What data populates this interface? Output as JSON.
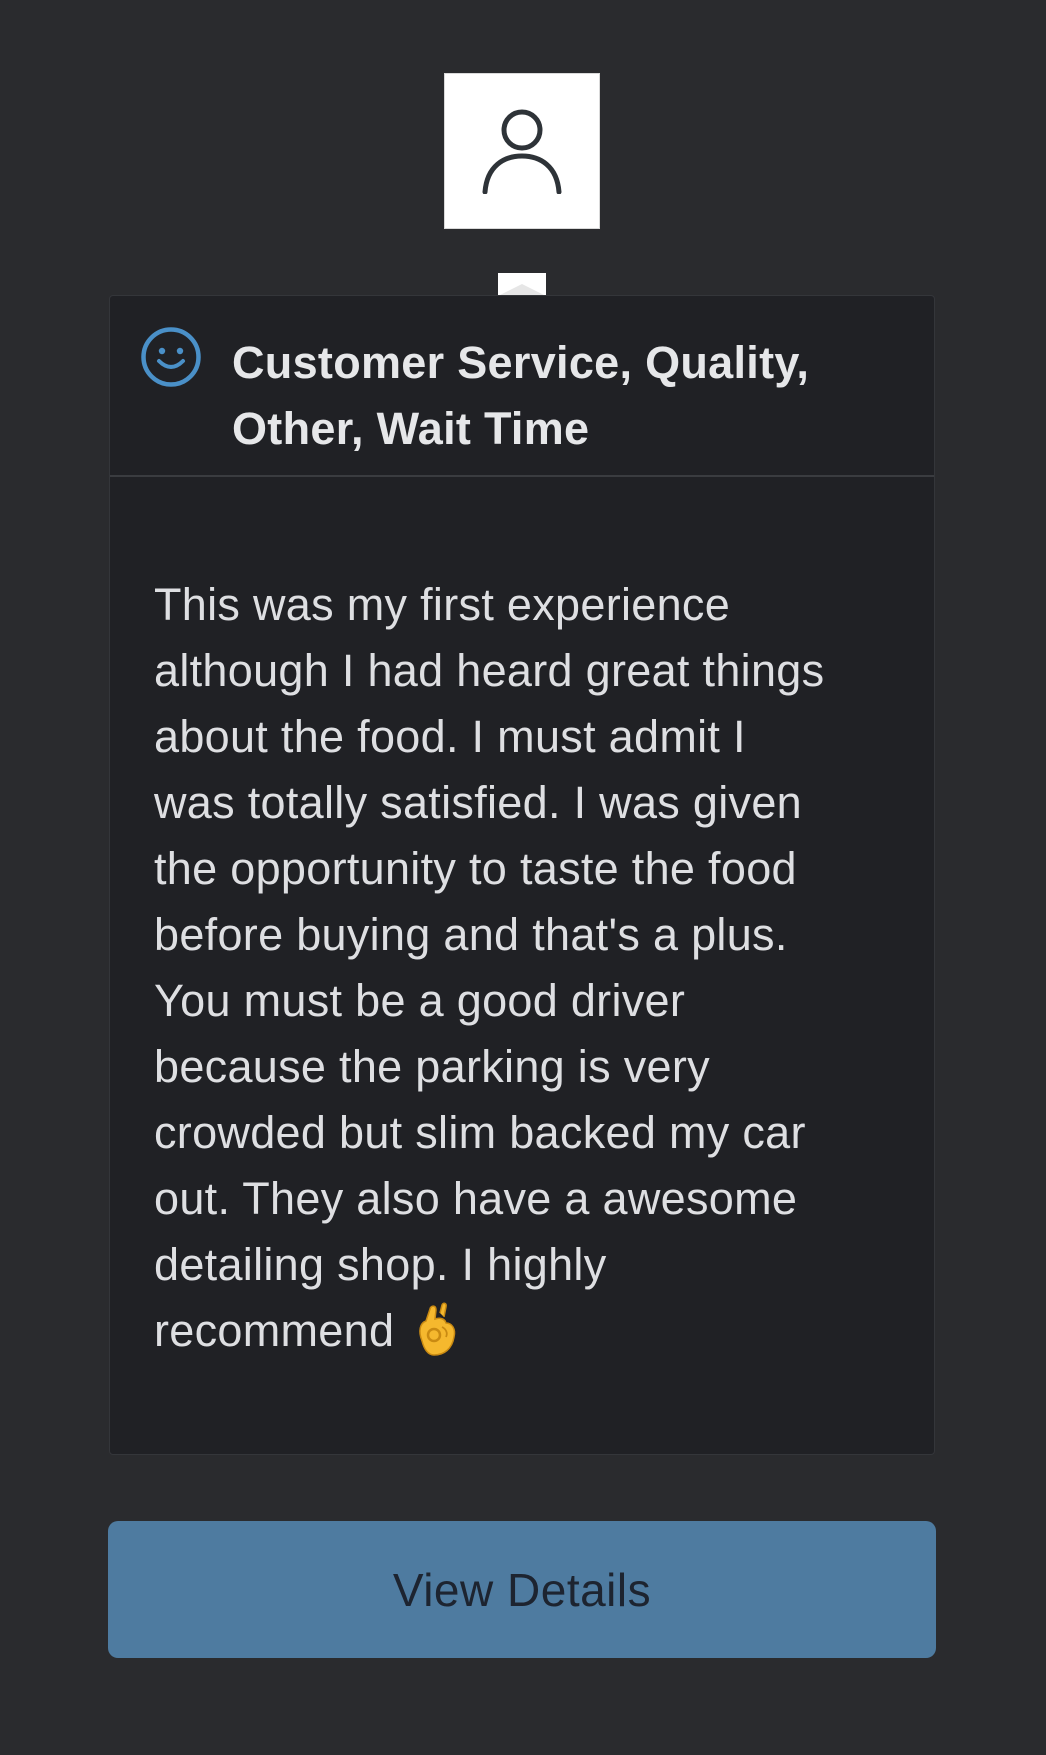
{
  "avatar": {
    "icon": "user-icon"
  },
  "card": {
    "header": {
      "icon": "smiley-icon",
      "icon_color": "#4a90c8",
      "lines": [
        "Customer Service, Quality,",
        "Other, Wait Time"
      ]
    },
    "review": {
      "lines": [
        "This was my first experience",
        "although I had heard great things",
        "about the food. I must admit I",
        "was totally satisfied. I was given",
        "the opportunity to taste the food",
        "before buying and that's a plus.",
        "You must be a good driver",
        "because the parking is very",
        "crowded but slim backed my car",
        "out. They also have a awesome",
        "detailing shop. I highly",
        "recommend"
      ],
      "emoji": "ok-hand-emoji"
    }
  },
  "actions": {
    "view_details_label": "View Details",
    "button_color": "#4e7ba0"
  }
}
